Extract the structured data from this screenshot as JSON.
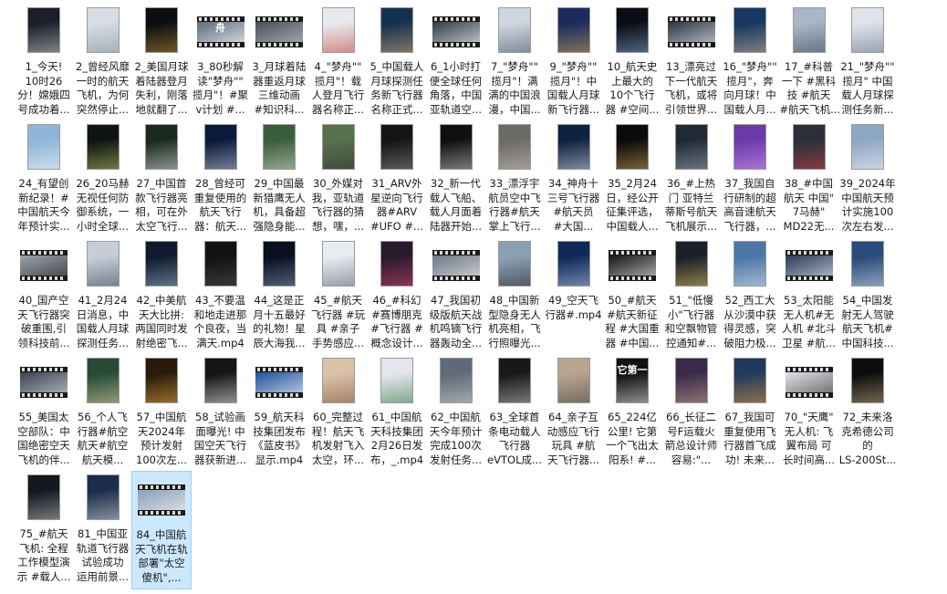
{
  "colors": {
    "selection_bg": "#cce8ff",
    "selection_border": "#99d1ff"
  },
  "files": [
    {
      "label": "1_今天!\n10时26\n分！嫦娥四\n号成功着...",
      "thumb": "tall",
      "bg": "#1c1f2a",
      "accent": "#dcdcdc"
    },
    {
      "label": "2_曾经风靡\n一时的航天\n飞机，为何\n突然停止...",
      "thumb": "tall",
      "bg": "#d7dde3",
      "accent": "#7b8796"
    },
    {
      "label": "2_美国月球\n着陆器登月\n失利，刚落\n地就翻了...",
      "thumb": "tall",
      "bg": "#0d0e12",
      "accent": "#c79a3a"
    },
    {
      "label": "3_80秒解\n读\"梦舟\"\"\n揽月\"！#聚\nv计划 #...",
      "thumb": "wide",
      "bg": "#5b6b7c",
      "accent": "#ffffff",
      "glyph": "舟"
    },
    {
      "label": "3_月球着陆\n器重返月球\n三维动画\n#知识科...",
      "thumb": "wide",
      "bg": "#4a4f58",
      "accent": "#bfc4cc"
    },
    {
      "label": "4_\"梦舟\"\"\n揽月\"！载\n人登月飞行\n器名称正...",
      "thumb": "tall",
      "bg": "#e7e9ee",
      "accent": "#c0392b"
    },
    {
      "label": "5_中国载人\n月球探测任\n务新飞行器\n名称正式...",
      "thumb": "tall",
      "bg": "#16314f",
      "accent": "#e2b07a"
    },
    {
      "label": "6_1小时打\n便全球任何\n角落，中国\n亚轨道空...",
      "thumb": "wide",
      "bg": "#2f3a46",
      "accent": "#f0f0f0"
    },
    {
      "label": "7_\"梦舟\"\"\n揽月\"！满\n满的中国浪\n漫，中国...",
      "thumb": "tall",
      "bg": "#cfd6df",
      "accent": "#3d4a5a"
    },
    {
      "label": "9_\"梦舟\"\"\n揽月\"！中\n国载人月球\n新飞行器...",
      "thumb": "tall",
      "bg": "#1d2b5c",
      "accent": "#d8b15a"
    },
    {
      "label": "10_航天史\n上最大的\n10个飞行\n器 #空间...",
      "thumb": "tall",
      "bg": "#0b0d14",
      "accent": "#8ab4e0"
    },
    {
      "label": "13_漂亮过\n下一代航天\n飞机，或将\n引领世界...",
      "thumb": "wide",
      "bg": "#2c3440",
      "accent": "#dfe4ea"
    },
    {
      "label": "16_\"梦舟\"\"\n揽月\"，奔\n向月球！中\n国载人月...",
      "thumb": "tall",
      "bg": "#173660",
      "accent": "#e0c29a"
    },
    {
      "label": "17_#科普\n一下 #黑科\n技 #航天\n#航天飞机...",
      "thumb": "tall",
      "bg": "#a9b6c6",
      "accent": "#2c3e50"
    },
    {
      "label": "21_\"梦舟\"\"\n揽月\" 中国\n载人月球探\n测任务新...",
      "thumb": "tall",
      "bg": "#dfe3ea",
      "accent": "#5a6a80"
    },
    {
      "label": "24_有望创\n新纪录！#\n中国航天今\n年预计实...",
      "thumb": "tall",
      "bg": "#8fb5d8",
      "accent": "#ffffff"
    },
    {
      "label": "26_20马赫\n无视任何防\n御系统，一\n小时全球...",
      "thumb": "tall",
      "bg": "#0e1512",
      "accent": "#c9d46a"
    },
    {
      "label": "27_中国首\n款飞行器亮\n相，可在外\n太空飞行...",
      "thumb": "tall",
      "bg": "#1a2a1f",
      "accent": "#f2f2f2"
    },
    {
      "label": "28_曾经可\n重复使用的\n航天飞行\n器：航天...",
      "thumb": "tall",
      "bg": "#0c1a3a",
      "accent": "#cfd8e6"
    },
    {
      "label": "29_中国最\n新猎鹰无人\n机，具备超\n强隐身能...",
      "thumb": "tall",
      "bg": "#3b5e3a",
      "accent": "#e4e4e4"
    },
    {
      "label": "30_外媒对\n我，亚轨道\n飞行器的猜\n想，嘿，...",
      "thumb": "tall",
      "bg": "#58714d",
      "accent": "#2a2a2a"
    },
    {
      "label": "31_ARV外\n星逆向飞行\n器#ARV\n#UFO #...",
      "thumb": "tall",
      "bg": "#141414",
      "accent": "#9a9a9a"
    },
    {
      "label": "32_新一代\n载人飞船、\n载人月面着\n陆器开始...",
      "thumb": "tall",
      "bg": "#101010",
      "accent": "#d9d9d9"
    },
    {
      "label": "33_漂浮宇\n航员空中飞\n行器#航天\n掌上飞行...",
      "thumb": "tall",
      "bg": "#6c6a66",
      "accent": "#d6cfc4"
    },
    {
      "label": "34_神舟十\n三号飞行器\n#航天员\n#大国...",
      "thumb": "tall",
      "bg": "#0e2140",
      "accent": "#e3edf7"
    },
    {
      "label": "35_2月24\n日，经公开\n征集评选，\n中国载人...",
      "thumb": "tall",
      "bg": "#0b0b0b",
      "accent": "#d9b25c"
    },
    {
      "label": "36_#上热\n门 亚特兰\n蒂斯号航天\n飞机展示...",
      "thumb": "tall",
      "bg": "#1f2a35",
      "accent": "#aab6c3"
    },
    {
      "label": "37_我国自\n行研制的超\n高音速航天\n飞行器，...",
      "thumb": "tall",
      "bg": "#6a3aa8",
      "accent": "#e6a8ff"
    },
    {
      "label": "38_#中国\n航天 中国\"\n7马赫\"\nMD22无...",
      "thumb": "tall",
      "bg": "#2b2f38",
      "accent": "#d64545"
    },
    {
      "label": "39_2024年\n中国航天预\n计实施100\n次左右发...",
      "thumb": "tall",
      "bg": "#8ea7c2",
      "accent": "#ffffff"
    },
    {
      "label": "40_国产空\n天飞行器突\n破重围,引\n领科技前...",
      "thumb": "wide",
      "bg": "#9aa4ad",
      "accent": "#2a2a2a"
    },
    {
      "label": "41_2月24\n日消息，中\n国载人月球\n探测任务...",
      "thumb": "tall",
      "bg": "#c7cdd6",
      "accent": "#2f3c4f"
    },
    {
      "label": "42_中美航\n天大比拼:\n两国同时发\n射绝密飞...",
      "thumb": "tall",
      "bg": "#0f1b2d",
      "accent": "#a8c3de"
    },
    {
      "label": "43_不要温\n和地走进那\n个良夜，当\n满天.mp4",
      "thumb": "tall",
      "bg": "#121212",
      "accent": "#5a5a5a"
    },
    {
      "label": "44_这是正\n月十五最好\n的礼物！星\n辰大海我...",
      "thumb": "tall",
      "bg": "#0a0f1f",
      "accent": "#8fa6c9"
    },
    {
      "label": "45_#航天\n飞行器 #玩\n具 #亲子\n手势感应...",
      "thumb": "tall",
      "bg": "#e8ebef",
      "accent": "#4a5a6e"
    },
    {
      "label": "46_#科幻\n#赛博朋克\n#飞行器 #\n概念设计...",
      "thumb": "tall",
      "bg": "#2a1a2e",
      "accent": "#e24a7a"
    },
    {
      "label": "47_我国初\n级版航天战\n机鸣镝飞行\n器轰动全...",
      "thumb": "wide",
      "bg": "#6c7785",
      "accent": "#e8e8e8"
    },
    {
      "label": "48_中国新\n型隐身无人\n机亮相，飞\n行照曝光...",
      "thumb": "tall",
      "bg": "#8ca0b3",
      "accent": "#1c1c1c"
    },
    {
      "label": "49_空天飞\n行器#.mp4",
      "thumb": "tall",
      "bg": "#0f2a5a",
      "accent": "#c9d9ee"
    },
    {
      "label": "50_#航天\n#航天新征\n程 #大国重\n器 #中国...",
      "thumb": "wide",
      "bg": "#141414",
      "accent": "#d8d8d8"
    },
    {
      "label": "51_\"低慢\n小\"飞行器\n和空飘物管\n控通知#...",
      "thumb": "tall",
      "bg": "#1a1f2a",
      "accent": "#f3d36b"
    },
    {
      "label": "52_西工大\n从沙漠中获\n得灵感，突\n破阻力极...",
      "thumb": "tall",
      "bg": "#4a77a8",
      "accent": "#f2f2f2"
    },
    {
      "label": "53_太阳能\n无人机#无\n人机 #北斗\n卫星 #航...",
      "thumb": "wide",
      "bg": "#2a3a55",
      "accent": "#d7dfe9"
    },
    {
      "label": "54_中国发\n射无人驾驶\n航天飞机#\n中国科技...",
      "thumb": "tall",
      "bg": "#274b7a",
      "accent": "#e8eef6"
    },
    {
      "label": "55_美国太\n空部队：中\n国绝密空天\n飞机的伴...",
      "thumb": "wide",
      "bg": "#3a4250",
      "accent": "#cfd5dd"
    },
    {
      "label": "56_个人飞\n行器#航空\n航天#航空\n航天模...",
      "thumb": "tall",
      "bg": "#274a35",
      "accent": "#f0e0b0"
    },
    {
      "label": "57_中国航\n天2024年\n预计发射\n100次左...",
      "thumb": "tall",
      "bg": "#2a1a0a",
      "accent": "#f5b84a"
    },
    {
      "label": "58_试验画\n面曝光! 中\n国空天飞行\n器获新进...",
      "thumb": "tall",
      "bg": "#151515",
      "accent": "#ffffff"
    },
    {
      "label": "59_航天科\n技集团发布\n《蓝皮书》\n显示.mp4",
      "thumb": "wide",
      "bg": "#1f4f9a",
      "accent": "#e9f0fa"
    },
    {
      "label": "60_完整过\n程！航天飞\n机发射飞入\n太空，环...",
      "thumb": "tall",
      "bg": "#d9c2a8",
      "accent": "#7a4a2a"
    },
    {
      "label": "61_中国航\n天科技集团\n2月26日发\n布，_.mp4",
      "thumb": "tall",
      "bg": "#e3e7ec",
      "accent": "#2c6e3a"
    },
    {
      "label": "62_中国航\n天今年预计\n完成100次\n发射任务...",
      "thumb": "tall",
      "bg": "#5e6a78",
      "accent": "#e0e0e0"
    },
    {
      "label": "63_全球首\n条电动载人\n飞行器\neVTOL成...",
      "thumb": "tall",
      "bg": "#181818",
      "accent": "#cfcfcf"
    },
    {
      "label": "64_亲子互\n动感应飞行\n玩具 #航\n天飞行器...",
      "thumb": "tall",
      "bg": "#b8a58e",
      "accent": "#3a3a3a"
    },
    {
      "label": "65_224亿\n公里! 它第\n一个飞出太\n阳系! #...",
      "thumb": "tall",
      "bg": "#111111",
      "accent": "#ffffff",
      "glyph": "它第一"
    },
    {
      "label": "66_长征二\n号F运载火\n箭总设计师\n容易:\"...",
      "thumb": "tall",
      "bg": "#3a2a4a",
      "accent": "#d9b39a"
    },
    {
      "label": "67_我国可\n重复使用飞\n行器首飞成\n功! 未来...",
      "thumb": "tall",
      "bg": "#203a5e",
      "accent": "#f0a040"
    },
    {
      "label": "70_\"天鹰\"\n无人机: 飞\n翼布局 可\n长时间高...",
      "thumb": "wide",
      "bg": "#dfe3e8",
      "accent": "#4a4a4a"
    },
    {
      "label": "72_未来洛\n克希德公司\n的\nLS-200St...",
      "thumb": "tall",
      "bg": "#0d0d0d",
      "accent": "#d2b48c"
    },
    {
      "label": "75_#航天\n飞机: 全程\n工作模型演\n示 #载人...",
      "thumb": "tall",
      "bg": "#121820",
      "accent": "#cfcfcf"
    },
    {
      "label": "81_中国亚\n轨道飞行器\n试验成功\n运用前景...",
      "thumb": "tall",
      "bg": "#1a2d4a",
      "accent": "#e6e6e6"
    },
    {
      "label": "84_中国航\n天飞机在轨\n部署\"太空\n傻机\",...",
      "thumb": "wide",
      "bg": "#8aa0b8",
      "accent": "#f4f4f4",
      "selected": true
    }
  ]
}
